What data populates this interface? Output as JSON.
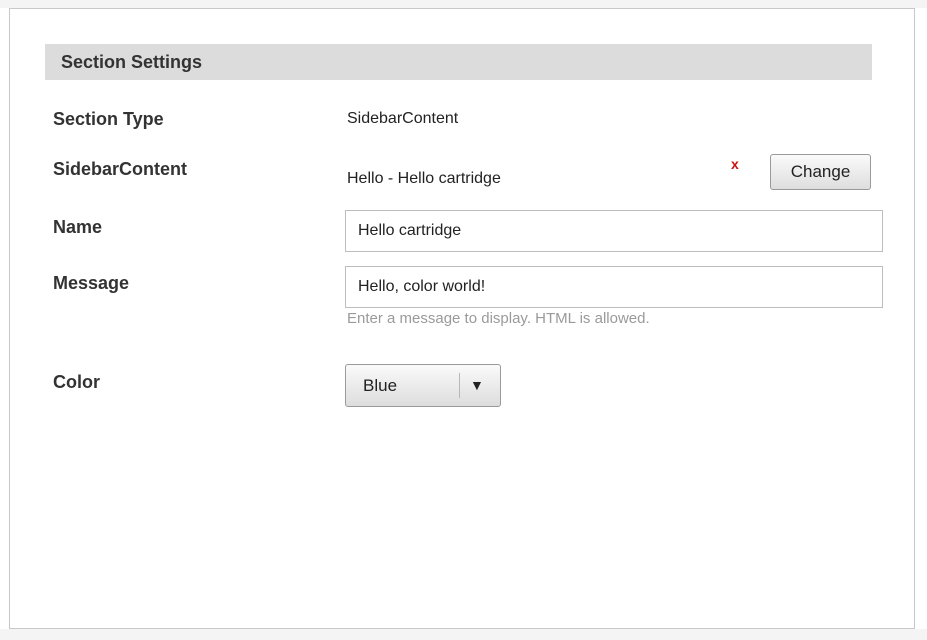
{
  "section": {
    "title": "Section Settings"
  },
  "fields": {
    "section_type": {
      "label": "Section Type",
      "value": "SidebarContent"
    },
    "sidebar_content": {
      "label": "SidebarContent",
      "value": "Hello - Hello cartridge",
      "remove_symbol": "x",
      "change_label": "Change"
    },
    "name": {
      "label": "Name",
      "value": "Hello cartridge"
    },
    "message": {
      "label": "Message",
      "value": "Hello, color world!",
      "help": "Enter a message to display. HTML is allowed."
    },
    "color": {
      "label": "Color",
      "selected": "Blue",
      "arrow": "▼"
    }
  },
  "colors": {
    "header_bg": "#dcdcdc",
    "remove_red": "#cc1111",
    "help_gray": "#9a9a9a"
  }
}
